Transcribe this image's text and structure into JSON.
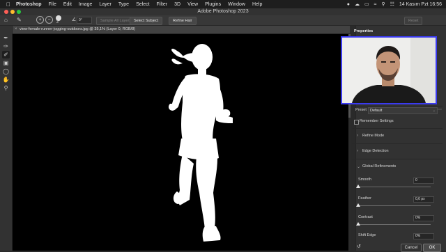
{
  "menubar": {
    "app_name": "Photoshop",
    "menus": [
      "File",
      "Edit",
      "Image",
      "Layer",
      "Type",
      "Select",
      "Filter",
      "3D",
      "View",
      "Plugins",
      "Window",
      "Help"
    ],
    "date_time": "14 Kasım Pzt  16:56"
  },
  "window": {
    "title": "Adobe Photoshop 2023"
  },
  "options_bar": {
    "size_value": "3",
    "angle_value": "0°",
    "sample_all_layers": "Sample All Layers",
    "select_subject": "Select Subject",
    "refine_hair": "Refine Hair",
    "reset_label": "Reset"
  },
  "document": {
    "tab_title": "view-female-runner-jogging-outdoors.jpg @ 35,1% (Layer 0, RGB/8)",
    "close_glyph": "×"
  },
  "properties": {
    "tab_label": "Properties",
    "preset_label": "Preset",
    "preset_value": "Default",
    "remember_settings": "Remember Settings",
    "sections": [
      "Refine Mode",
      "Edge Detection",
      "Global Refinements"
    ],
    "sliders": [
      {
        "label": "Smooth",
        "value": "0",
        "level": 0.0
      },
      {
        "label": "Feather",
        "value": "0,0 px",
        "level": 0.0
      },
      {
        "label": "Contrast",
        "value": "0%",
        "level": 0.0
      },
      {
        "label": "Shift Edge",
        "value": "0%",
        "level": 0.5
      }
    ],
    "cancel": "Cancel",
    "ok": "OK"
  },
  "colors": {
    "accent_blue": "#3a3af0",
    "ok_button": "#4a4a4a",
    "canvas_bg": "#000000",
    "mask_fg": "#ffffff"
  }
}
